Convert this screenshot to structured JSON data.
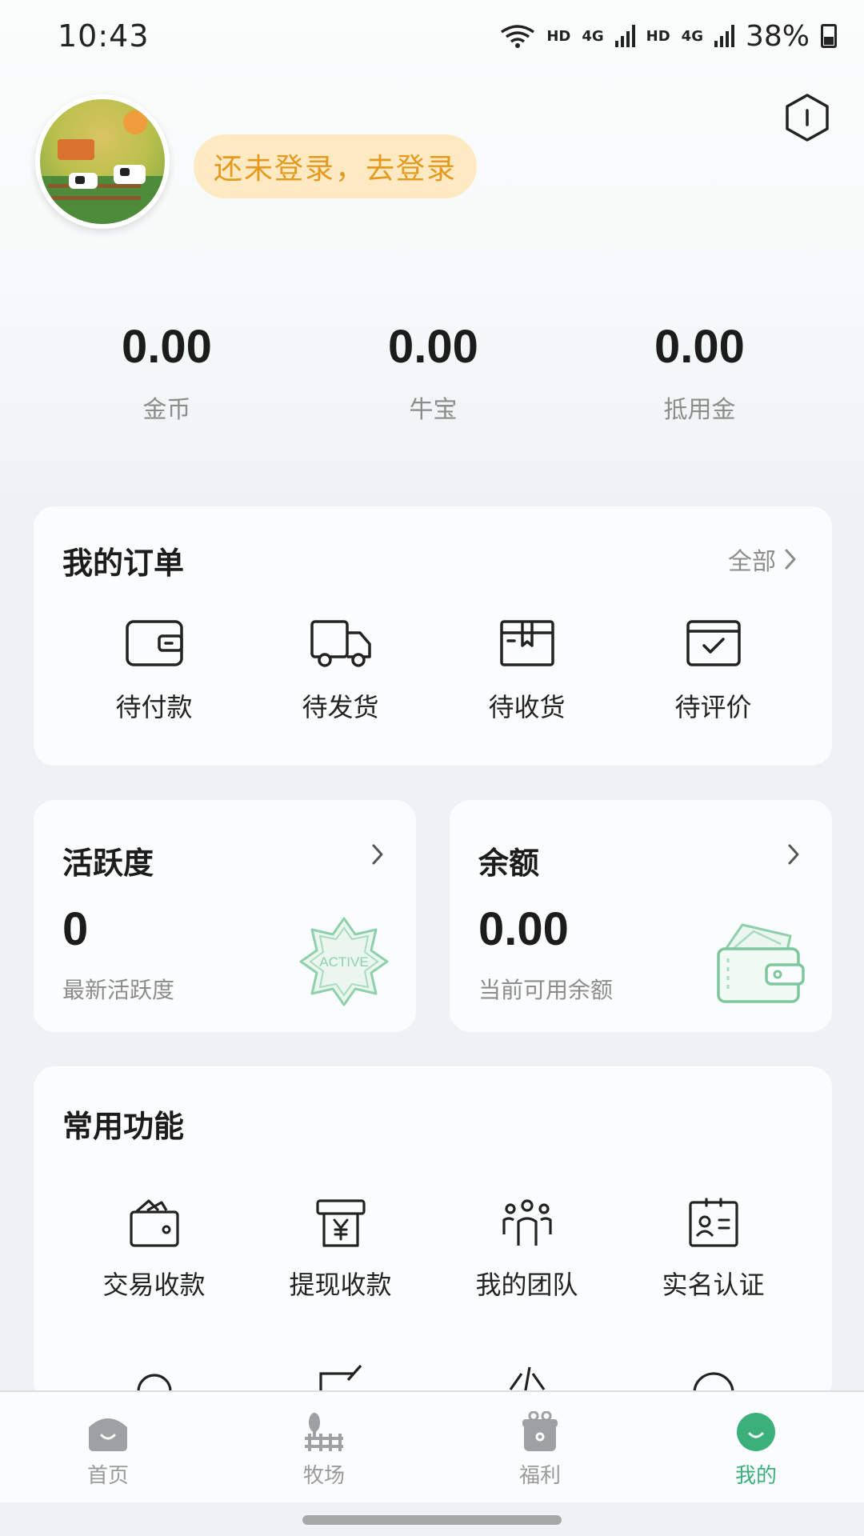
{
  "status_bar": {
    "time": "10:43",
    "hd1": "HD",
    "net1": "4G",
    "hd2": "HD",
    "net2": "4G",
    "battery": "38%"
  },
  "profile": {
    "login_prompt": "还未登录，去登录"
  },
  "stats": [
    {
      "value": "0.00",
      "label": "金币"
    },
    {
      "value": "0.00",
      "label": "牛宝"
    },
    {
      "value": "0.00",
      "label": "抵用金"
    }
  ],
  "orders": {
    "title": "我的订单",
    "all_label": "全部",
    "items": [
      {
        "label": "待付款",
        "icon": "wallet-icon"
      },
      {
        "label": "待发货",
        "icon": "truck-icon"
      },
      {
        "label": "待收货",
        "icon": "package-icon"
      },
      {
        "label": "待评价",
        "icon": "review-icon"
      }
    ]
  },
  "activity": {
    "title": "活跃度",
    "value": "0",
    "subtitle": "最新活跃度",
    "badge": "ACTIVE"
  },
  "balance": {
    "title": "余额",
    "value": "0.00",
    "subtitle": "当前可用余额"
  },
  "functions": {
    "title": "常用功能",
    "items": [
      {
        "label": "交易收款",
        "icon": "receive-payment-icon"
      },
      {
        "label": "提现收款",
        "icon": "withdraw-icon"
      },
      {
        "label": "我的团队",
        "icon": "team-icon"
      },
      {
        "label": "实名认证",
        "icon": "id-card-icon"
      }
    ]
  },
  "bottom_nav": {
    "items": [
      {
        "label": "首页",
        "icon": "home-icon",
        "active": false
      },
      {
        "label": "牧场",
        "icon": "ranch-icon",
        "active": false
      },
      {
        "label": "福利",
        "icon": "gift-icon",
        "active": false
      },
      {
        "label": "我的",
        "icon": "profile-icon",
        "active": true
      }
    ]
  },
  "colors": {
    "accent_green": "#3bb07a",
    "login_text": "#e39a1e",
    "login_bg": "#fde9c2"
  }
}
